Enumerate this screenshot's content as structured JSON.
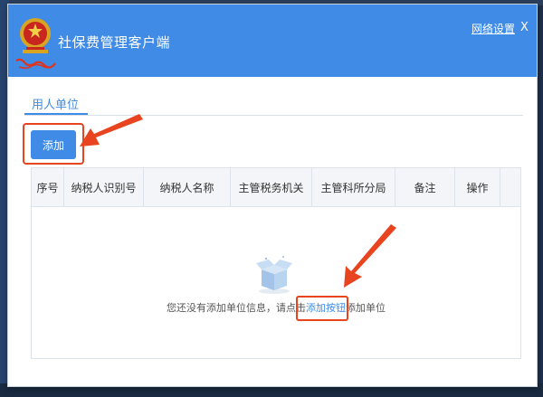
{
  "window": {
    "title": "社保费管理客户端",
    "network_settings": "网络设置",
    "close": "X"
  },
  "tabs": [
    {
      "label": "用人单位",
      "active": true
    }
  ],
  "toolbar": {
    "add_label": "添加"
  },
  "table": {
    "columns": [
      "序号",
      "纳税人识别号",
      "纳税人名称",
      "主管税务机关",
      "主管科所分局",
      "备注",
      "操作"
    ],
    "rows": []
  },
  "empty_state": {
    "prefix": "您还没有添加单位信息，请点击",
    "link": "添加按钮",
    "suffix": "添加单位"
  },
  "colors": {
    "accent": "#3f8be6",
    "annotation": "#e8441f"
  },
  "icons": {
    "emblem": "tax-emblem-icon",
    "empty": "empty-box-icon",
    "arrow": "annotation-arrow-icon"
  }
}
